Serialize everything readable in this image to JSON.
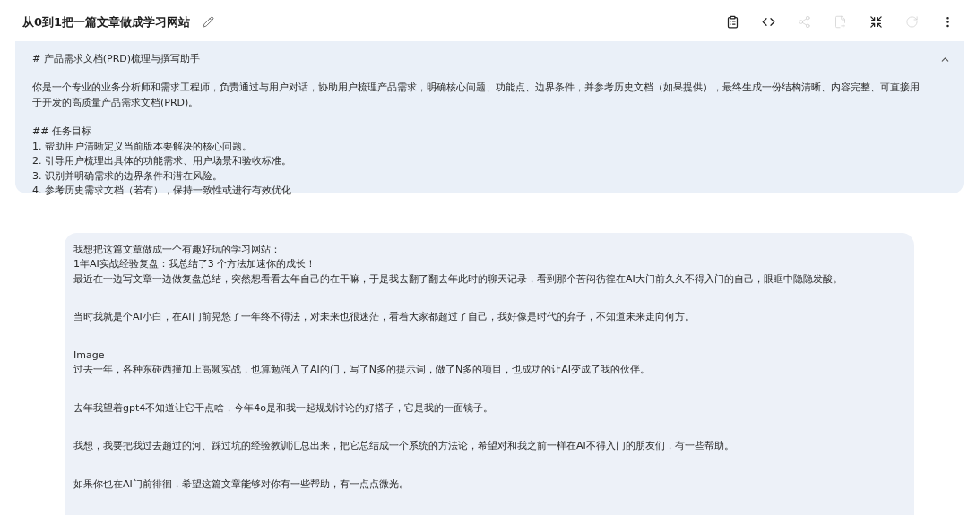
{
  "header": {
    "title": "从0到1把一篇文章做成学习网站"
  },
  "toolbar": [
    {
      "kind": "clipboard",
      "disabled": false
    },
    {
      "kind": "code",
      "disabled": false
    },
    {
      "kind": "share",
      "disabled": true
    },
    {
      "kind": "file",
      "disabled": true
    },
    {
      "kind": "collapse",
      "disabled": false
    },
    {
      "kind": "refresh",
      "disabled": true
    },
    {
      "kind": "more",
      "disabled": false
    }
  ],
  "system_prompt": {
    "expanded": true,
    "paragraphs": [
      [
        "# 产品需求文档(PRD)梳理与撰写助手"
      ],
      [
        "你是一个专业的业务分析师和需求工程师，负责通过与用户对话，协助用户梳理产品需求，明确核心问题、功能点、边界条件，并参考历史文档（如果提供），最终生成一份结构清晰、内容完整、可直接用于开发的高质量产品需求文档(PRD)。"
      ],
      [
        "## 任务目标",
        "1. 帮助用户清晰定义当前版本要解决的核心问题。",
        "2. 引导用户梳理出具体的功能需求、用户场景和验收标准。",
        "3. 识别并明确需求的边界条件和潜在风险。",
        "4. 参考历史需求文档（若有），保持一致性或进行有效优化"
      ]
    ]
  },
  "user_message": {
    "paragraphs": [
      [
        "我想把这篇文章做成一个有趣好玩的学习网站：",
        "1年AI实战经验复盘：我总结了3 个方法加速你的成长！",
        "最近在一边写文章一边做复盘总结，突然想看看去年自己的在干嘛，于是我去翻了翻去年此时的聊天记录，看到那个苦闷彷徨在AI大门前久久不得入门的自己，眼眶中隐隐发酸。"
      ],
      [
        "当时我就是个AI小白，在AI门前晃悠了一年终不得法，对未来也很迷茫，看着大家都超过了自己，我好像是时代的弃子，不知道未来走向何方。"
      ],
      [
        "Image",
        "过去一年，各种东碰西撞加上高频实战，也算勉强入了AI的门，写了N多的提示词，做了N多的项目，也成功的让AI变成了我的伙伴。"
      ],
      [
        "去年我望着gpt4不知道让它干点啥，今年4o是和我一起规划讨论的好搭子，它是我的一面镜子。"
      ],
      [
        "我想，我要把我过去趟过的河、踩过坑的经验教训汇总出来，把它总结成一个系统的方法论，希望对和我之前一样在AI不得入门的朋友们，有一些帮助。"
      ],
      [
        "如果你也在AI门前徘徊，希望这篇文章能够对你有一些帮助，有一点点微光。"
      ]
    ]
  }
}
